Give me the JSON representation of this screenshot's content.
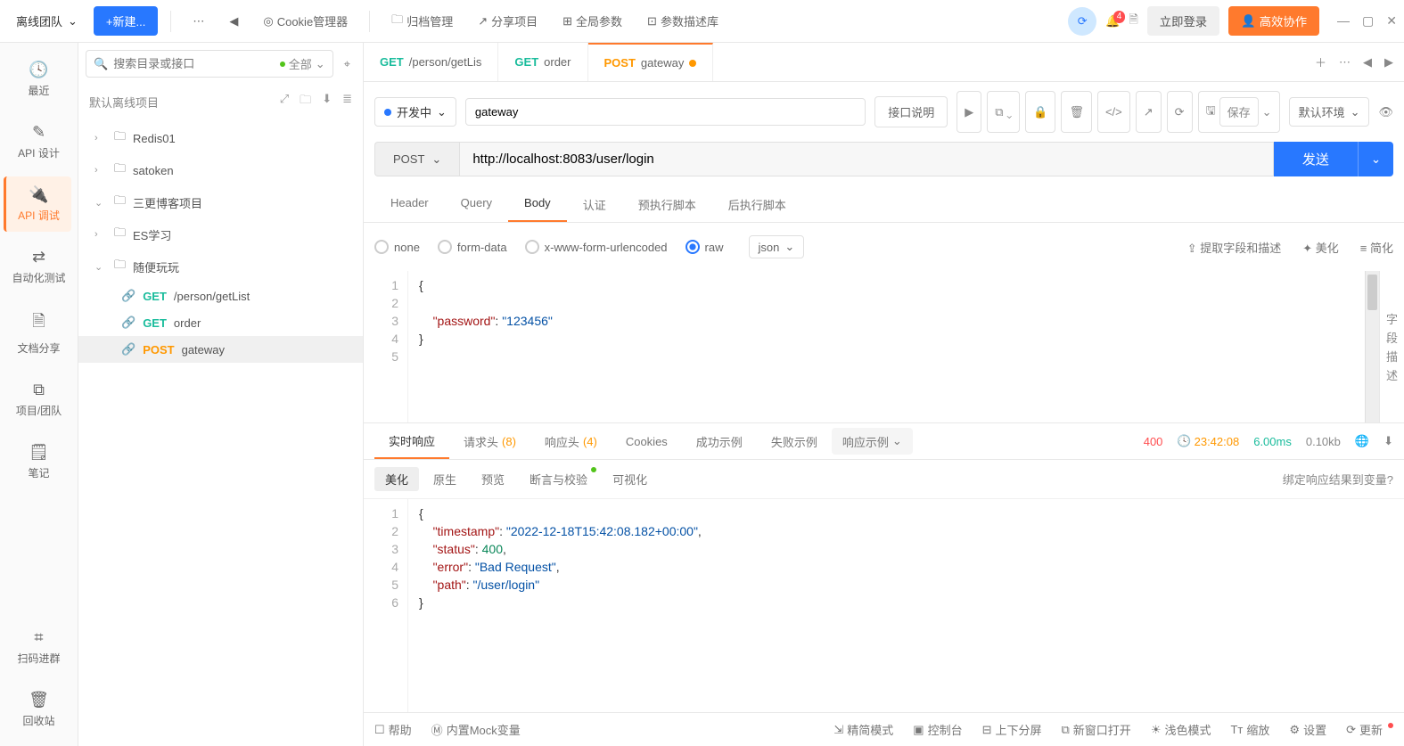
{
  "topbar": {
    "team": "离线团队",
    "new_btn": "+新建...",
    "back_icon": "◀",
    "cookie_mgr": "Cookie管理器",
    "archive": "归档管理",
    "share": "分享项目",
    "global_params": "全局参数",
    "param_desc": "参数描述库",
    "notif_count": "4",
    "login": "立即登录",
    "collab": "高效协作"
  },
  "leftnav": {
    "recent": "最近",
    "api_design": "API 设计",
    "api_debug": "API 调试",
    "auto_test": "自动化测试",
    "doc_share": "文档分享",
    "proj_team": "项目/团队",
    "notes": "笔记",
    "scan_group": "扫码进群",
    "recycle": "回收站"
  },
  "sidebar": {
    "search_placeholder": "搜索目录或接口",
    "filter_all": "全部",
    "project": "默认离线项目",
    "folders": {
      "redis": "Redis01",
      "satoken": "satoken",
      "blog": "三更博客项目",
      "es": "ES学习",
      "play": "随便玩玩"
    },
    "apis": {
      "getlist_method": "GET",
      "getlist_path": "/person/getList",
      "order_method": "GET",
      "order_name": "order",
      "gateway_method": "POST",
      "gateway_name": "gateway"
    }
  },
  "tabs": {
    "t1_method": "GET",
    "t1_name": "/person/getLis",
    "t2_method": "GET",
    "t2_name": "order",
    "t3_method": "POST",
    "t3_name": "gateway"
  },
  "request": {
    "status": "开发中",
    "name": "gateway",
    "desc_btn": "接口说明",
    "save": "保存",
    "env": "默认环境",
    "method": "POST",
    "url": "http://localhost:8083/user/login",
    "send": "发送",
    "req_tabs": {
      "header": "Header",
      "query": "Query",
      "body": "Body",
      "auth": "认证",
      "pre": "预执行脚本",
      "post": "后执行脚本"
    },
    "body_types": {
      "none": "none",
      "formdata": "form-data",
      "xwww": "x-www-form-urlencoded",
      "raw": "raw",
      "json": "json"
    },
    "body_actions": {
      "extract": "提取字段和描述",
      "beautify": "美化",
      "simplify": "简化"
    },
    "body_code": {
      "l1": "{",
      "l3_key": "\"password\"",
      "l3_val": "\"123456\"",
      "l4": "}"
    },
    "side_label": "字段描述"
  },
  "response": {
    "tabs": {
      "realtime": "实时响应",
      "req_headers": "请求头",
      "req_headers_cnt": "(8)",
      "resp_headers": "响应头",
      "resp_headers_cnt": "(4)",
      "cookies": "Cookies",
      "success_ex": "成功示例",
      "fail_ex": "失败示例",
      "resp_ex": "响应示例"
    },
    "meta": {
      "status": "400",
      "time": "23:42:08",
      "duration": "6.00ms",
      "size": "0.10kb"
    },
    "view_tabs": {
      "beautify": "美化",
      "raw": "原生",
      "preview": "预览",
      "assert": "断言与校验",
      "visual": "可视化"
    },
    "bind_link": "绑定响应结果到变量?",
    "body": {
      "l1": "{",
      "l2_k": "\"timestamp\"",
      "l2_v": "\"2022-12-18T15:42:08.182+00:00\"",
      "l3_k": "\"status\"",
      "l3_v": "400",
      "l4_k": "\"error\"",
      "l4_v": "\"Bad Request\"",
      "l5_k": "\"path\"",
      "l5_v": "\"/user/login\"",
      "l6": "}"
    }
  },
  "footer": {
    "help": "帮助",
    "mock": "内置Mock变量",
    "compact": "精简模式",
    "console": "控制台",
    "split": "上下分屏",
    "new_win": "新窗口打开",
    "theme": "浅色模式",
    "zoom": "缩放",
    "settings": "设置",
    "update": "更新"
  }
}
